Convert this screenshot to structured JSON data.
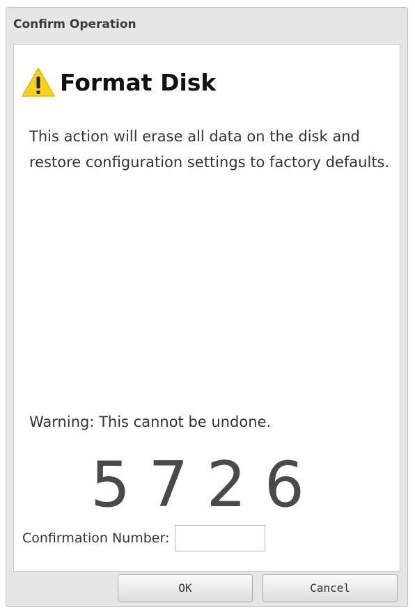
{
  "dialog": {
    "title": "Confirm Operation",
    "heading": "Format Disk",
    "description": "This action will erase all data on the disk and restore configuration settings to factory defaults.",
    "warning": "Warning: This cannot be undone.",
    "confirmation_code": "5726",
    "confirmation_label": "Confirmation Number:",
    "confirmation_value": "",
    "ok_label": "OK",
    "cancel_label": "Cancel",
    "warning_icon": "warning-triangle-icon",
    "colors": {
      "warning_yellow": "#f7d21c",
      "background": "#e6e6e6"
    }
  }
}
